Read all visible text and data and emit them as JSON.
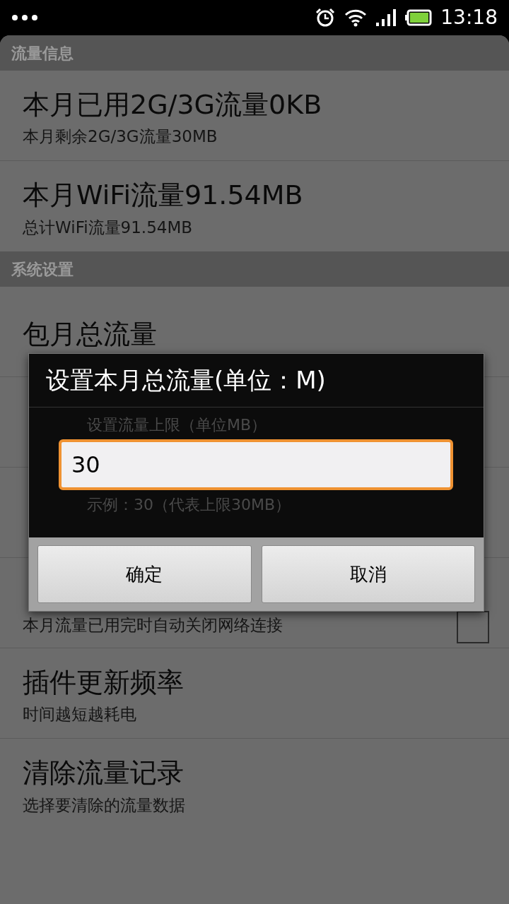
{
  "status_bar": {
    "time": "13:18"
  },
  "sections": [
    {
      "header": "流量信息",
      "items": [
        {
          "title": "本月已用2G/3G流量0KB",
          "subtitle": "本月剩余2G/3G流量30MB"
        },
        {
          "title": "本月WiFi流量91.54MB",
          "subtitle": "总计WiFi流量91.54MB"
        }
      ]
    },
    {
      "header": "系统设置",
      "items": [
        {
          "kind": "text",
          "title": "包月总流量"
        },
        {
          "kind": "text"
        },
        {
          "kind": "text"
        },
        {
          "kind": "checkbox",
          "subtitle": "本月流量已用完时自动关闭网络连接",
          "checked": false
        },
        {
          "kind": "text",
          "title": "插件更新频率",
          "subtitle": "时间越短越耗电"
        },
        {
          "kind": "text",
          "title": "清除流量记录",
          "subtitle": "选择要清除的流量数据"
        }
      ]
    }
  ],
  "dialog": {
    "title": "设置本月总流量(单位：M)",
    "label": "设置流量上限（单位MB）",
    "value": "30",
    "hint": "示例：30（代表上限30MB）",
    "buttons": [
      "确定",
      "取消"
    ]
  }
}
